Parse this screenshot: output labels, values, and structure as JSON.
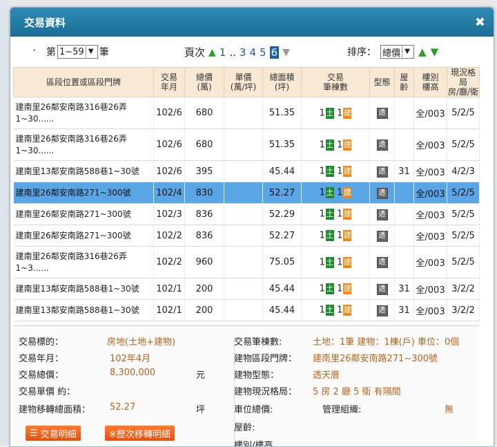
{
  "dialog": {
    "title": "交易資料",
    "close_icon": "✖"
  },
  "toolbar": {
    "range_prefix": "第",
    "range_value": "1~59",
    "range_suffix": "筆",
    "pager_label": "頁次",
    "pages": [
      "1",
      "..",
      "3",
      "4",
      "5",
      "6"
    ],
    "current_page": "6",
    "sort_label": "排序：",
    "sort_value": "總價"
  },
  "table": {
    "headers": [
      "區段位置或區段門牌",
      "交易\n年月",
      "總價\n(萬)",
      "單價\n(萬/坪)",
      "總面積\n(坪)",
      "交易\n筆棟數",
      "型態",
      "屋\n齡",
      "樓別\n樓高",
      "現況格局\n房/廳/衛"
    ],
    "land_tag": "土",
    "building_tag": "建",
    "type_icon_text": "透",
    "rows": [
      {
        "loc": "建南里26鄰安南路316巷26弄1~30......",
        "ym": "102/6",
        "total": "680",
        "unit": "",
        "area": "51.35",
        "land": "1",
        "bld": "1",
        "age": "",
        "floor": "全/003",
        "layout": "5/2/5"
      },
      {
        "loc": "建南里26鄰安南路316巷26弄1~30......",
        "ym": "102/6",
        "total": "680",
        "unit": "",
        "area": "51.35",
        "land": "1",
        "bld": "1",
        "age": "",
        "floor": "全/003",
        "layout": "5/2/5"
      },
      {
        "loc": "建南里13鄰安南路588巷1~30號",
        "ym": "102/6",
        "total": "395",
        "unit": "",
        "area": "45.44",
        "land": "1",
        "bld": "1",
        "age": "31",
        "floor": "全/003",
        "layout": "4/2/3"
      },
      {
        "loc": "建南里26鄰安南路271~300號",
        "ym": "102/4",
        "total": "830",
        "unit": "",
        "area": "52.27",
        "land": "1",
        "bld": "1",
        "age": "",
        "floor": "全/003",
        "layout": "5/2/5"
      },
      {
        "loc": "建南里26鄰安南路271~300號",
        "ym": "102/3",
        "total": "836",
        "unit": "",
        "area": "52.29",
        "land": "1",
        "bld": "1",
        "age": "",
        "floor": "全/003",
        "layout": "5/2/5"
      },
      {
        "loc": "建南里26鄰安南路271~300號",
        "ym": "102/2",
        "total": "836",
        "unit": "",
        "area": "52.27",
        "land": "1",
        "bld": "1",
        "age": "",
        "floor": "全/003",
        "layout": "5/2/5"
      },
      {
        "loc": "建南里26鄰安南路316巷26弄1~3......",
        "ym": "102/2",
        "total": "960",
        "unit": "",
        "area": "75.05",
        "land": "1",
        "bld": "1",
        "age": "",
        "floor": "全/003",
        "layout": "5/2/5"
      },
      {
        "loc": "建南里13鄰安南路588巷1~30號",
        "ym": "102/1",
        "total": "200",
        "unit": "",
        "area": "45.44",
        "land": "1",
        "bld": "1",
        "age": "31",
        "floor": "全/003",
        "layout": "3/2/2"
      },
      {
        "loc": "建南里13鄰安南路588巷1~30號",
        "ym": "102/1",
        "total": "200",
        "unit": "",
        "area": "45.44",
        "land": "1",
        "bld": "1",
        "age": "31",
        "floor": "全/003",
        "layout": "3/2/2"
      }
    ]
  },
  "details": {
    "target_label": "交易標的：",
    "target_value": "房地(土地+建物)",
    "ym_label": "交易年月：",
    "ym_value": "102年4月",
    "total_label": "交易總價：",
    "total_value": "8,300,000",
    "total_unit": "元",
    "unit_label": "交易單價 約：",
    "area_label": "建物移轉總面積：",
    "area_value": "52.27",
    "area_unit": "坪",
    "count_label": "交易筆棟數:",
    "count_value": "土地：1筆 建物：1棟(戶) 車位：0個",
    "addr_label": "建物區段門牌：",
    "addr_value": "建南里26鄰安南路271~300號",
    "btype_label": "建物型態：",
    "btype_value": "透天厝",
    "layout_label": "建物現況格局：",
    "layout_value": "5 房 2 廳 5 衛 有隔間",
    "parking_label": "車位總價:",
    "mgmt_label": "管理組織:",
    "mgmt_value": "無",
    "age_label": "屋齡:",
    "floor_label_cut": "樓別/樓高"
  },
  "buttons": {
    "detail": "交易明細",
    "history": "※歷次移轉明細"
  },
  "colors": {
    "titlebar": "#1b6d96",
    "header_bg": "#f7e9d4",
    "selected_row": "#59a6e6",
    "value_text": "#b8621b",
    "button": "#e4500c"
  }
}
